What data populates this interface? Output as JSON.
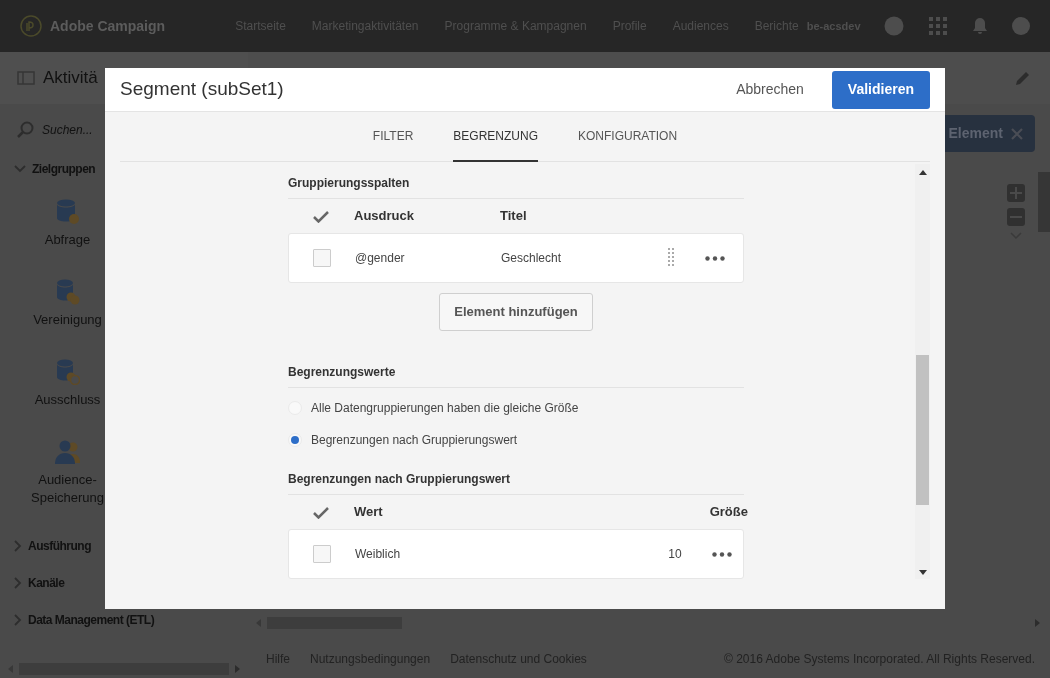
{
  "app": {
    "brand": "Adobe Campaign",
    "nav": [
      "Startseite",
      "Marketingaktivitäten",
      "Programme & Kampagnen",
      "Profile",
      "Audiences",
      "Berichte"
    ],
    "user": "be-acsdev"
  },
  "sidebar": {
    "title": "Aktivitä",
    "search": {
      "placeholder": "Suchen..."
    },
    "groups": [
      {
        "label": "Zielgruppen",
        "expanded": true,
        "items": [
          {
            "label": "Abfrage",
            "kind": "query"
          },
          {
            "label": "Vereinigung",
            "kind": "union"
          },
          {
            "label": "Ausschluss",
            "kind": "exclusion"
          },
          {
            "label": "Audience-Speicherung",
            "kind": "save"
          }
        ]
      },
      {
        "label": "Ausführung",
        "expanded": false
      },
      {
        "label": "Kanäle",
        "expanded": false
      },
      {
        "label": "Data Management (ETL)",
        "expanded": false
      }
    ]
  },
  "canvas": {
    "button": "Element"
  },
  "footer": {
    "links": [
      "Hilfe",
      "Nutzungsbedingungen",
      "Datenschutz und Cookies"
    ],
    "copyright": "© 2016 Adobe Systems Incorporated. All Rights Reserved."
  },
  "dialog": {
    "title": "Segment (subSet1)",
    "cancel": "Abbrechen",
    "confirm": "Validieren",
    "tabs": [
      {
        "label": "FILTER",
        "selected": false
      },
      {
        "label": "BEGRENZUNG",
        "selected": true
      },
      {
        "label": "KONFIGURATION",
        "selected": false
      }
    ],
    "sections": [
      {
        "kind": "table",
        "title": "Gruppierungsspalten",
        "columns": [
          "Ausdruck",
          "Titel"
        ],
        "rows": [
          {
            "cells": [
              "@gender",
              "Geschlecht"
            ],
            "checked": false,
            "draggable": true
          }
        ],
        "add_button": "Element hinzufügen"
      },
      {
        "kind": "radios",
        "title": "Begrenzungswerte",
        "options": [
          {
            "label": "Alle Datengruppierungen haben die gleiche Größe",
            "selected": false
          },
          {
            "label": "Begrenzungen nach Gruppierungswert",
            "selected": true
          }
        ]
      },
      {
        "kind": "table",
        "title": "Begrenzungen nach Gruppierungswert",
        "columns": [
          "Wert",
          "Größe"
        ],
        "rows": [
          {
            "cells": [
              "Weiblich",
              "10"
            ],
            "checked": false,
            "draggable": false
          }
        ]
      }
    ]
  }
}
